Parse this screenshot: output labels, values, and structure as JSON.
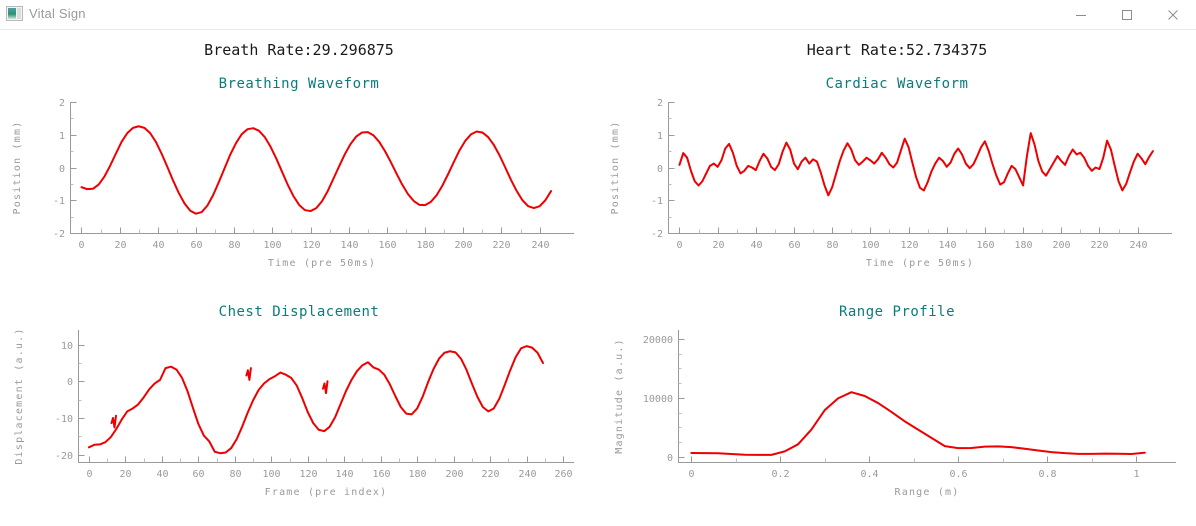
{
  "window": {
    "title": "Vital Sign",
    "icon": "app-window-icon",
    "controls": {
      "minimize": "minimize-icon",
      "maximize": "maximize-icon",
      "close": "close-icon"
    }
  },
  "readouts": {
    "breath_rate": "Breath Rate:29.296875",
    "heart_rate": "Heart Rate:52.734375"
  },
  "colors": {
    "title_teal": "#0b7c7c",
    "trace_red": "#ee0000",
    "axis_gray": "#9a9a9a",
    "text_dark": "#1a1a1a"
  },
  "chart_data": [
    {
      "id": "breathing",
      "type": "line",
      "title": "Breathing Waveform",
      "xlabel": "Time (pre 50ms)",
      "ylabel": "Position (mm)",
      "xlim": [
        -6,
        258
      ],
      "ylim": [
        -2,
        2
      ],
      "xticks": [
        0,
        20,
        40,
        60,
        80,
        100,
        120,
        140,
        160,
        180,
        200,
        220,
        240
      ],
      "yticks": [
        -2,
        -1,
        0,
        1,
        2
      ],
      "grid": false,
      "legend": "none",
      "x": [
        0,
        3,
        6,
        9,
        12,
        15,
        18,
        21,
        24,
        27,
        30,
        33,
        36,
        39,
        42,
        45,
        48,
        51,
        54,
        57,
        60,
        63,
        66,
        69,
        72,
        75,
        78,
        81,
        84,
        87,
        90,
        93,
        96,
        99,
        102,
        105,
        108,
        111,
        114,
        117,
        120,
        123,
        126,
        129,
        132,
        135,
        138,
        141,
        144,
        147,
        150,
        153,
        156,
        159,
        162,
        165,
        168,
        171,
        174,
        177,
        180,
        183,
        186,
        189,
        192,
        195,
        198,
        201,
        204,
        207,
        210,
        213,
        216,
        219,
        222,
        225,
        228,
        231,
        234,
        237,
        240,
        243,
        246,
        249
      ],
      "y": [
        -0.6,
        -0.66,
        -0.65,
        -0.52,
        -0.28,
        0.05,
        0.42,
        0.78,
        1.05,
        1.21,
        1.26,
        1.21,
        1.05,
        0.78,
        0.42,
        0.02,
        -0.4,
        -0.78,
        -1.1,
        -1.32,
        -1.41,
        -1.36,
        -1.16,
        -0.84,
        -0.44,
        -0.02,
        0.4,
        0.75,
        1.02,
        1.17,
        1.2,
        1.12,
        0.93,
        0.64,
        0.28,
        -0.12,
        -0.52,
        -0.87,
        -1.14,
        -1.3,
        -1.33,
        -1.24,
        -1.03,
        -0.72,
        -0.34,
        0.04,
        0.41,
        0.72,
        0.95,
        1.07,
        1.08,
        0.98,
        0.78,
        0.5,
        0.17,
        -0.18,
        -0.52,
        -0.81,
        -1.02,
        -1.14,
        -1.15,
        -1.05,
        -0.85,
        -0.56,
        -0.21,
        0.16,
        0.52,
        0.81,
        1.01,
        1.1,
        1.07,
        0.93,
        0.69,
        0.37,
        0.0,
        -0.38,
        -0.72,
        -1.0,
        -1.18,
        -1.24,
        -1.18,
        -1.0,
        -0.72
      ]
    },
    {
      "id": "cardiac",
      "type": "line",
      "title": "Cardiac Waveform",
      "xlabel": "Time (pre 50ms)",
      "ylabel": "Position (mm)",
      "xlim": [
        -6,
        258
      ],
      "ylim": [
        -2,
        2
      ],
      "xticks": [
        0,
        20,
        40,
        60,
        80,
        100,
        120,
        140,
        160,
        180,
        200,
        220,
        240
      ],
      "yticks": [
        -2,
        -1,
        0,
        1,
        2
      ],
      "grid": false,
      "legend": "none",
      "x": [
        0,
        2,
        4,
        6,
        8,
        10,
        12,
        14,
        16,
        18,
        20,
        22,
        24,
        26,
        28,
        30,
        32,
        34,
        36,
        38,
        40,
        42,
        44,
        46,
        48,
        50,
        52,
        54,
        56,
        58,
        60,
        62,
        64,
        66,
        68,
        70,
        72,
        74,
        76,
        78,
        80,
        82,
        84,
        86,
        88,
        90,
        92,
        94,
        96,
        98,
        100,
        102,
        104,
        106,
        108,
        110,
        112,
        114,
        116,
        118,
        120,
        122,
        124,
        126,
        128,
        130,
        132,
        134,
        136,
        138,
        140,
        142,
        144,
        146,
        148,
        150,
        152,
        154,
        156,
        158,
        160,
        162,
        164,
        166,
        168,
        170,
        172,
        174,
        176,
        178,
        180,
        182,
        184,
        186,
        188,
        190,
        192,
        194,
        196,
        198,
        200,
        202,
        204,
        206,
        208,
        210,
        212,
        214,
        216,
        218,
        220,
        222,
        224,
        226,
        228,
        230,
        232,
        234,
        236,
        238,
        240,
        242,
        244,
        246,
        248
      ],
      "y": [
        0.08,
        0.44,
        0.3,
        -0.1,
        -0.42,
        -0.55,
        -0.42,
        -0.18,
        0.05,
        0.12,
        0.02,
        0.22,
        0.58,
        0.72,
        0.45,
        0.05,
        -0.18,
        -0.1,
        0.05,
        0.0,
        -0.08,
        0.2,
        0.42,
        0.28,
        0.02,
        -0.08,
        0.1,
        0.48,
        0.76,
        0.55,
        0.12,
        -0.05,
        0.18,
        0.3,
        0.12,
        0.25,
        0.18,
        -0.15,
        -0.55,
        -0.85,
        -0.6,
        -0.2,
        0.2,
        0.52,
        0.74,
        0.55,
        0.22,
        0.08,
        0.18,
        0.3,
        0.22,
        0.12,
        0.25,
        0.45,
        0.3,
        0.1,
        0.0,
        0.15,
        0.52,
        0.88,
        0.62,
        0.15,
        -0.3,
        -0.62,
        -0.7,
        -0.45,
        -0.12,
        0.12,
        0.3,
        0.2,
        0.02,
        0.15,
        0.42,
        0.58,
        0.4,
        0.12,
        -0.02,
        0.1,
        0.35,
        0.62,
        0.8,
        0.5,
        0.1,
        -0.25,
        -0.52,
        -0.45,
        -0.18,
        0.05,
        -0.05,
        -0.3,
        -0.55,
        0.35,
        1.05,
        0.7,
        0.2,
        -0.12,
        -0.25,
        -0.05,
        0.15,
        0.35,
        0.2,
        0.08,
        0.35,
        0.55,
        0.4,
        0.45,
        0.3,
        0.05,
        -0.1,
        0.0,
        -0.05,
        0.3,
        0.82,
        0.55,
        0.05,
        -0.42,
        -0.7,
        -0.5,
        -0.15,
        0.18,
        0.42,
        0.28,
        0.1,
        0.32,
        0.5,
        0.3
      ]
    },
    {
      "id": "chest",
      "type": "line",
      "title": "Chest Displacement",
      "xlabel": "Frame (pre index)",
      "ylabel": "Displacement (a.u.)",
      "xlim": [
        -6,
        266
      ],
      "ylim": [
        -22,
        14
      ],
      "xticks": [
        0,
        20,
        40,
        60,
        80,
        100,
        120,
        140,
        160,
        180,
        200,
        220,
        240,
        260
      ],
      "yticks": [
        -20,
        -10,
        0,
        10
      ],
      "grid": false,
      "legend": "none",
      "x": [
        0,
        3,
        6,
        9,
        12,
        15,
        18,
        21,
        24,
        27,
        30,
        33,
        36,
        39,
        42,
        45,
        48,
        51,
        54,
        57,
        60,
        63,
        66,
        69,
        72,
        75,
        78,
        81,
        84,
        87,
        90,
        93,
        96,
        99,
        102,
        105,
        108,
        111,
        114,
        117,
        120,
        123,
        126,
        129,
        132,
        135,
        138,
        141,
        144,
        147,
        150,
        153,
        156,
        159,
        162,
        165,
        168,
        171,
        174,
        177,
        180,
        183,
        186,
        189,
        192,
        195,
        198,
        201,
        204,
        207,
        210,
        213,
        216,
        219,
        222,
        225,
        228,
        231,
        234,
        237,
        240,
        243,
        246,
        249
      ],
      "y": [
        -18.0,
        -17.3,
        -17.2,
        -16.6,
        -15.2,
        -13.0,
        -10.4,
        -8.2,
        -7.4,
        -6.3,
        -4.4,
        -2.2,
        -0.6,
        0.4,
        3.6,
        4.0,
        3.2,
        1.0,
        -2.6,
        -7.2,
        -11.6,
        -14.8,
        -16.4,
        -19.2,
        -19.6,
        -19.4,
        -18.2,
        -15.8,
        -12.4,
        -8.6,
        -5.2,
        -2.4,
        -0.6,
        0.6,
        1.4,
        2.4,
        1.8,
        0.9,
        -1.2,
        -4.6,
        -8.4,
        -11.4,
        -13.2,
        -13.6,
        -12.4,
        -9.8,
        -6.2,
        -2.6,
        0.4,
        2.8,
        4.4,
        5.2,
        3.8,
        3.2,
        1.8,
        -0.8,
        -4.0,
        -7.0,
        -8.8,
        -9.0,
        -7.4,
        -4.2,
        -0.2,
        3.4,
        6.2,
        7.8,
        8.2,
        7.9,
        6.2,
        3.2,
        -0.6,
        -4.2,
        -7.0,
        -8.2,
        -7.4,
        -4.8,
        -1.0,
        3.0,
        6.6,
        9.0,
        9.6,
        9.2,
        7.8,
        5.0
      ],
      "glitches": [
        {
          "x": 14,
          "y_from": -11.4,
          "y_to": -10.0
        },
        {
          "x": 88,
          "y_from": 1.6,
          "y_to": 3.0
        },
        {
          "x": 130,
          "y_from": -2.0,
          "y_to": -0.6
        }
      ]
    },
    {
      "id": "range",
      "type": "line",
      "title": "Range Profile",
      "xlabel": "Range (m)",
      "ylabel": "Magnitude (a.u.)",
      "xlim": [
        -0.03,
        1.09
      ],
      "ylim": [
        -900,
        21500
      ],
      "xticks": [
        0,
        0.2,
        0.4,
        0.6,
        0.8,
        1
      ],
      "yticks": [
        0,
        10000,
        20000
      ],
      "grid": false,
      "legend": "none",
      "x": [
        0.0,
        0.03,
        0.06,
        0.09,
        0.12,
        0.15,
        0.18,
        0.21,
        0.24,
        0.27,
        0.3,
        0.33,
        0.36,
        0.39,
        0.42,
        0.45,
        0.48,
        0.51,
        0.54,
        0.57,
        0.6,
        0.63,
        0.66,
        0.69,
        0.72,
        0.75,
        0.78,
        0.81,
        0.84,
        0.87,
        0.9,
        0.93,
        0.96,
        0.99,
        1.02
      ],
      "y": [
        620,
        600,
        580,
        450,
        330,
        300,
        310,
        900,
        2100,
        4600,
        7900,
        9900,
        10950,
        10300,
        9100,
        7600,
        6000,
        4600,
        3200,
        1800,
        1450,
        1480,
        1700,
        1750,
        1620,
        1350,
        1050,
        780,
        600,
        480,
        480,
        520,
        500,
        460,
        680
      ]
    }
  ]
}
